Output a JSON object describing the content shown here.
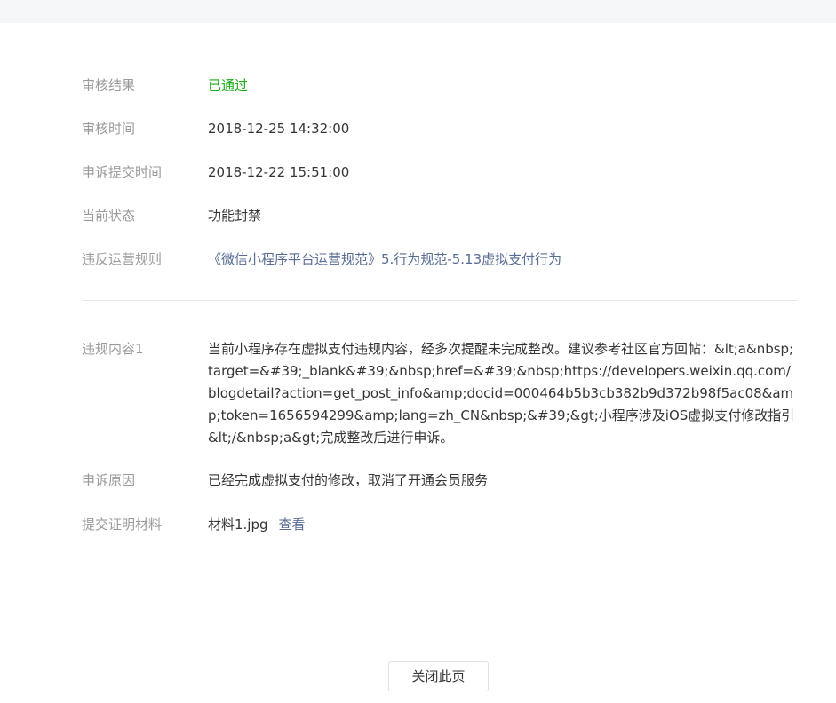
{
  "detail": {
    "review_result": {
      "label": "审核结果",
      "value": "已通过",
      "status_color": "#1aad19"
    },
    "review_time": {
      "label": "审核时间",
      "value": "2018-12-25 14:32:00"
    },
    "appeal_submit_time": {
      "label": "申诉提交时间",
      "value": "2018-12-22 15:51:00"
    },
    "current_status": {
      "label": "当前状态",
      "value": "功能封禁"
    },
    "violated_rule": {
      "label": "违反运营规则",
      "value": "《微信小程序平台运营规范》5.行为规范-5.13虚拟支付行为"
    },
    "violation_content": {
      "label": "违规内容1",
      "value": "当前小程序存在虚拟支付违规内容，经多次提醒未完成整改。建议参考社区官方回帖：&lt;a&nbsp;target=&#39;_blank&#39;&nbsp;href=&#39;&nbsp;https://developers.weixin.qq.com/blogdetail?action=get_post_info&amp;docid=000464b5b3cb382b9d372b98f5ac08&amp;token=1656594299&amp;lang=zh_CN&nbsp;&#39;&gt;小程序涉及iOS虚拟支付修改指引&lt;/&nbsp;a&gt;完成整改后进行申诉。"
    },
    "appeal_reason": {
      "label": "申诉原因",
      "value": "已经完成虚拟支付的修改，取消了开通会员服务"
    },
    "evidence": {
      "label": "提交证明材料",
      "file_name": "材料1.jpg",
      "view_label": "查看"
    }
  },
  "footer": {
    "close_label": "关闭此页"
  },
  "colors": {
    "link": "#576b95",
    "label": "#9a9a9a",
    "text": "#353535",
    "success": "#1aad19",
    "divider": "#e7e7eb",
    "topbar": "#f6f7f9"
  }
}
